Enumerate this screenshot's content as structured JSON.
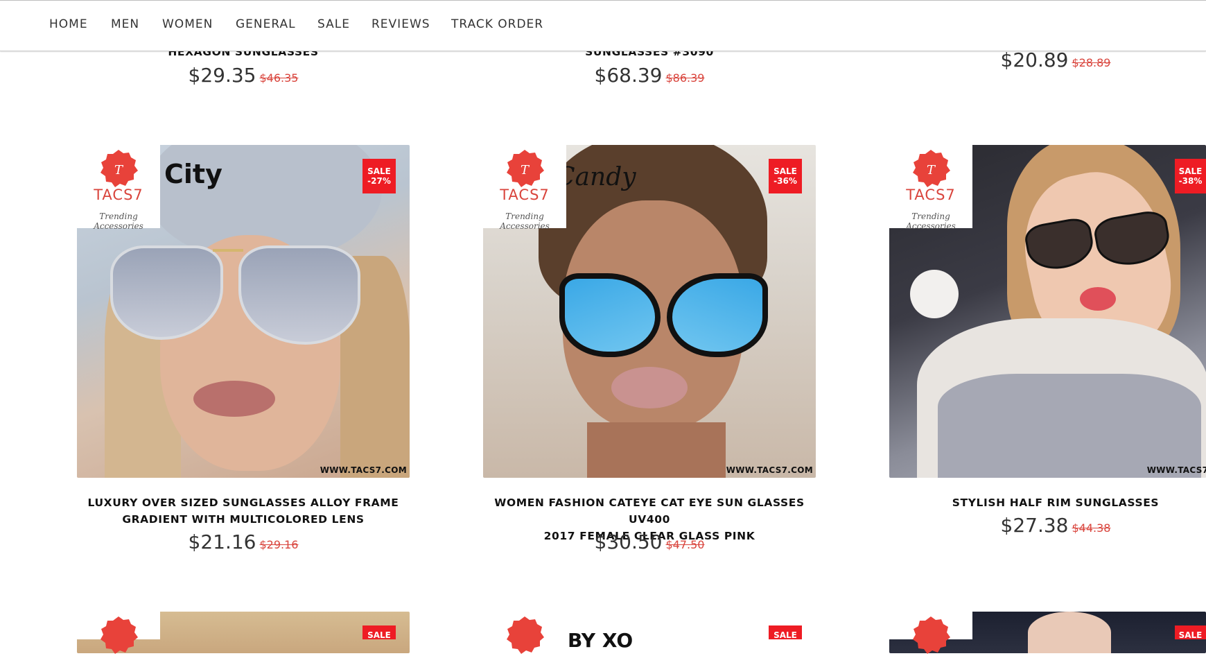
{
  "nav": {
    "items": [
      "HOME",
      "MEN",
      "WOMEN",
      "GENERAL",
      "SALE",
      "REVIEWS",
      "TRACK ORDER"
    ]
  },
  "top_row": [
    {
      "name": "HEXAGON SUNGLASSES",
      "price": "$29.35",
      "old_price": "$46.35"
    },
    {
      "name": "SUNGLASSES #3090",
      "price": "$68.39",
      "old_price": "$86.39"
    },
    {
      "name": "",
      "price": "$20.89",
      "old_price": "$28.89"
    }
  ],
  "brand": {
    "name": "TACS7",
    "tagline": "Trending Accessories",
    "watermark": "WWW.TACS7.COM"
  },
  "products": [
    {
      "name_line1": "LUXURY OVER SIZED SUNGLASSES ALLOY FRAME",
      "name_line2": "GRADIENT WITH MULTICOLORED LENS",
      "price": "$21.16",
      "old_price": "$29.16",
      "badge_line1": "SALE",
      "badge_line2": "-27%",
      "photo_caption": "City"
    },
    {
      "name_line1": "WOMEN FASHION CATEYE CAT EYE SUN GLASSES UV400",
      "name_line2": "2017 FEMALE CLEAR GLASS PINK",
      "price": "$30.50",
      "old_price": "$47.50",
      "badge_line1": "SALE",
      "badge_line2": "-36%",
      "photo_caption": "Candy"
    },
    {
      "name_line1": "STYLISH HALF RIM SUNGLASSES",
      "name_line2": "",
      "price": "$27.38",
      "old_price": "$44.38",
      "badge_line1": "SALE",
      "badge_line2": "-38%",
      "photo_caption": ""
    }
  ],
  "bottom_row": [
    {
      "badge_line1": "SALE",
      "photo_caption": ""
    },
    {
      "badge_line1": "SALE",
      "photo_caption": "BY XO"
    },
    {
      "badge_line1": "SALE",
      "photo_caption": ""
    }
  ],
  "colors": {
    "sale_red": "#ee1c24",
    "brand_red": "#d9443c",
    "old_price": "#d9443c",
    "nav_text": "#333333"
  }
}
